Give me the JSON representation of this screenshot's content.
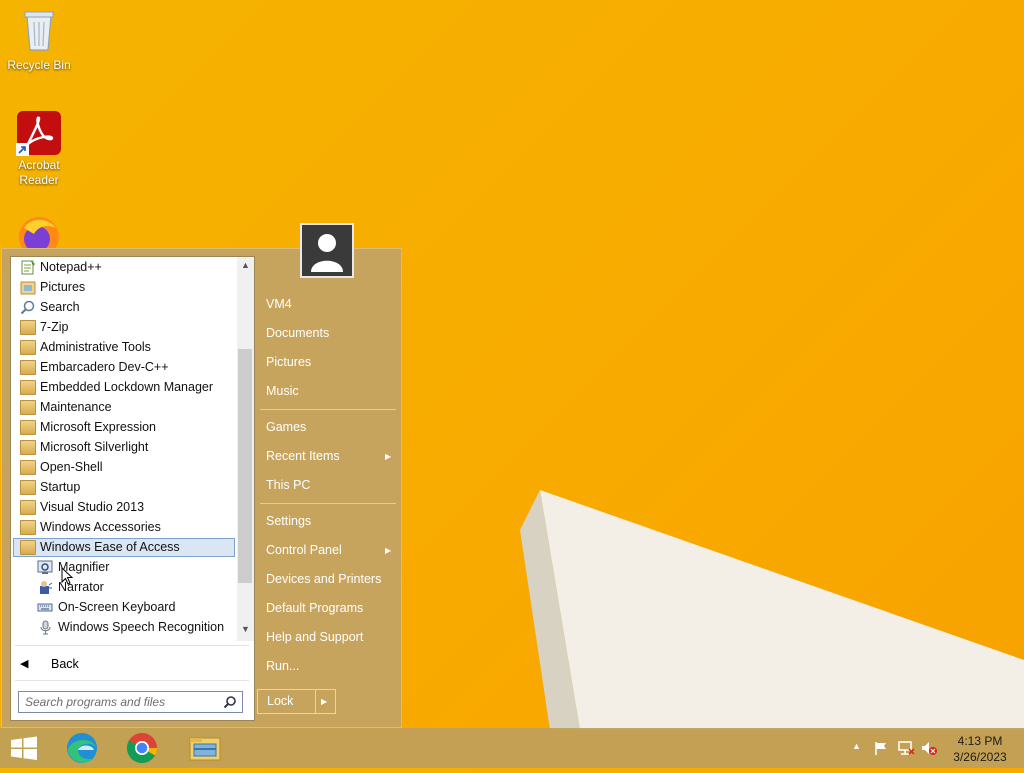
{
  "desktop": {
    "icons": [
      {
        "label": "Recycle Bin"
      },
      {
        "label": "Acrobat\nReader"
      },
      {
        "label": ""
      }
    ]
  },
  "start_menu": {
    "programs": [
      {
        "label": "Notepad++",
        "icon": "notepad-icon"
      },
      {
        "label": "Pictures",
        "icon": "pictures-icon"
      },
      {
        "label": "Search",
        "icon": "search-icon"
      },
      {
        "label": "7-Zip",
        "icon": "folder-icon"
      },
      {
        "label": "Administrative Tools",
        "icon": "folder-icon"
      },
      {
        "label": "Embarcadero Dev-C++",
        "icon": "folder-icon"
      },
      {
        "label": "Embedded Lockdown Manager",
        "icon": "folder-icon"
      },
      {
        "label": "Maintenance",
        "icon": "folder-icon"
      },
      {
        "label": "Microsoft Expression",
        "icon": "folder-icon"
      },
      {
        "label": "Microsoft Silverlight",
        "icon": "folder-icon"
      },
      {
        "label": "Open-Shell",
        "icon": "folder-icon"
      },
      {
        "label": "Startup",
        "icon": "folder-icon"
      },
      {
        "label": "Visual Studio 2013",
        "icon": "folder-icon"
      },
      {
        "label": "Windows Accessories",
        "icon": "folder-icon"
      },
      {
        "label": "Windows Ease of Access",
        "icon": "folder-icon",
        "selected": true
      }
    ],
    "subitems": [
      {
        "label": "Magnifier",
        "icon": "magnifier-icon"
      },
      {
        "label": "Narrator",
        "icon": "narrator-icon"
      },
      {
        "label": "On-Screen Keyboard",
        "icon": "keyboard-icon"
      },
      {
        "label": "Windows Speech Recognition",
        "icon": "microphone-icon"
      }
    ],
    "back_label": "Back",
    "search_placeholder": "Search programs and files",
    "right": {
      "user": "VM4",
      "items": [
        {
          "label": "Documents"
        },
        {
          "label": "Pictures"
        },
        {
          "label": "Music"
        },
        {
          "label": "Games"
        },
        {
          "label": "Recent Items",
          "submenu": true
        },
        {
          "label": "This PC"
        },
        {
          "label": "Settings"
        },
        {
          "label": "Control Panel",
          "submenu": true
        },
        {
          "label": "Devices and Printers"
        },
        {
          "label": "Default Programs"
        },
        {
          "label": "Help and Support"
        },
        {
          "label": "Run..."
        }
      ],
      "lock_label": "Lock"
    }
  },
  "taskbar": {
    "apps": [
      "start-icon",
      "edge-icon",
      "chrome-icon",
      "file-explorer-icon"
    ],
    "clock_time": "4:13 PM",
    "clock_date": "3/26/2023"
  },
  "colors": {
    "desktop": "#f7ad00",
    "menu": "#c7a45d",
    "selection": "#dbe6f5"
  }
}
